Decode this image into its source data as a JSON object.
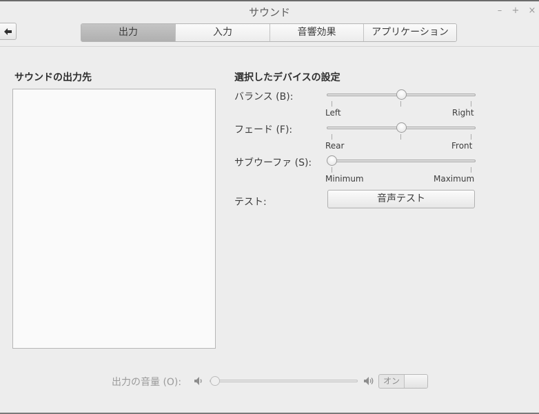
{
  "window": {
    "title": "サウンド",
    "controls": {
      "minimize": "–",
      "maximize": "+",
      "close": "×"
    }
  },
  "toolbar": {
    "back_icon": "arrow-left-icon"
  },
  "tabs": [
    {
      "label": "出力",
      "active": true
    },
    {
      "label": "入力",
      "active": false
    },
    {
      "label": "音響効果",
      "active": false
    },
    {
      "label": "アプリケーション",
      "active": false
    }
  ],
  "output_devices": {
    "title": "サウンドの出力先",
    "items": []
  },
  "device_settings": {
    "title": "選択したデバイスの設定",
    "balance": {
      "label": "バランス (B):",
      "min_label": "Left",
      "max_label": "Right",
      "value": 0.5
    },
    "fade": {
      "label": "フェード (F):",
      "min_label": "Rear",
      "max_label": "Front",
      "value": 0.5
    },
    "subwoofer": {
      "label": "サブウーファ (S):",
      "min_label": "Minimum",
      "max_label": "Maximum",
      "value": 0.0
    },
    "test": {
      "label": "テスト:",
      "button_label": "音声テスト"
    }
  },
  "volume": {
    "label": "出力の音量 (O):",
    "low_icon": "speaker-low-icon",
    "high_icon": "speaker-high-icon",
    "value": 0.0,
    "switch_label": "オン"
  },
  "colors": {
    "background": "#ededed",
    "active_tab": "#b8b8b8",
    "text": "#3c3c3c",
    "disabled_text": "#9a9a9a"
  }
}
